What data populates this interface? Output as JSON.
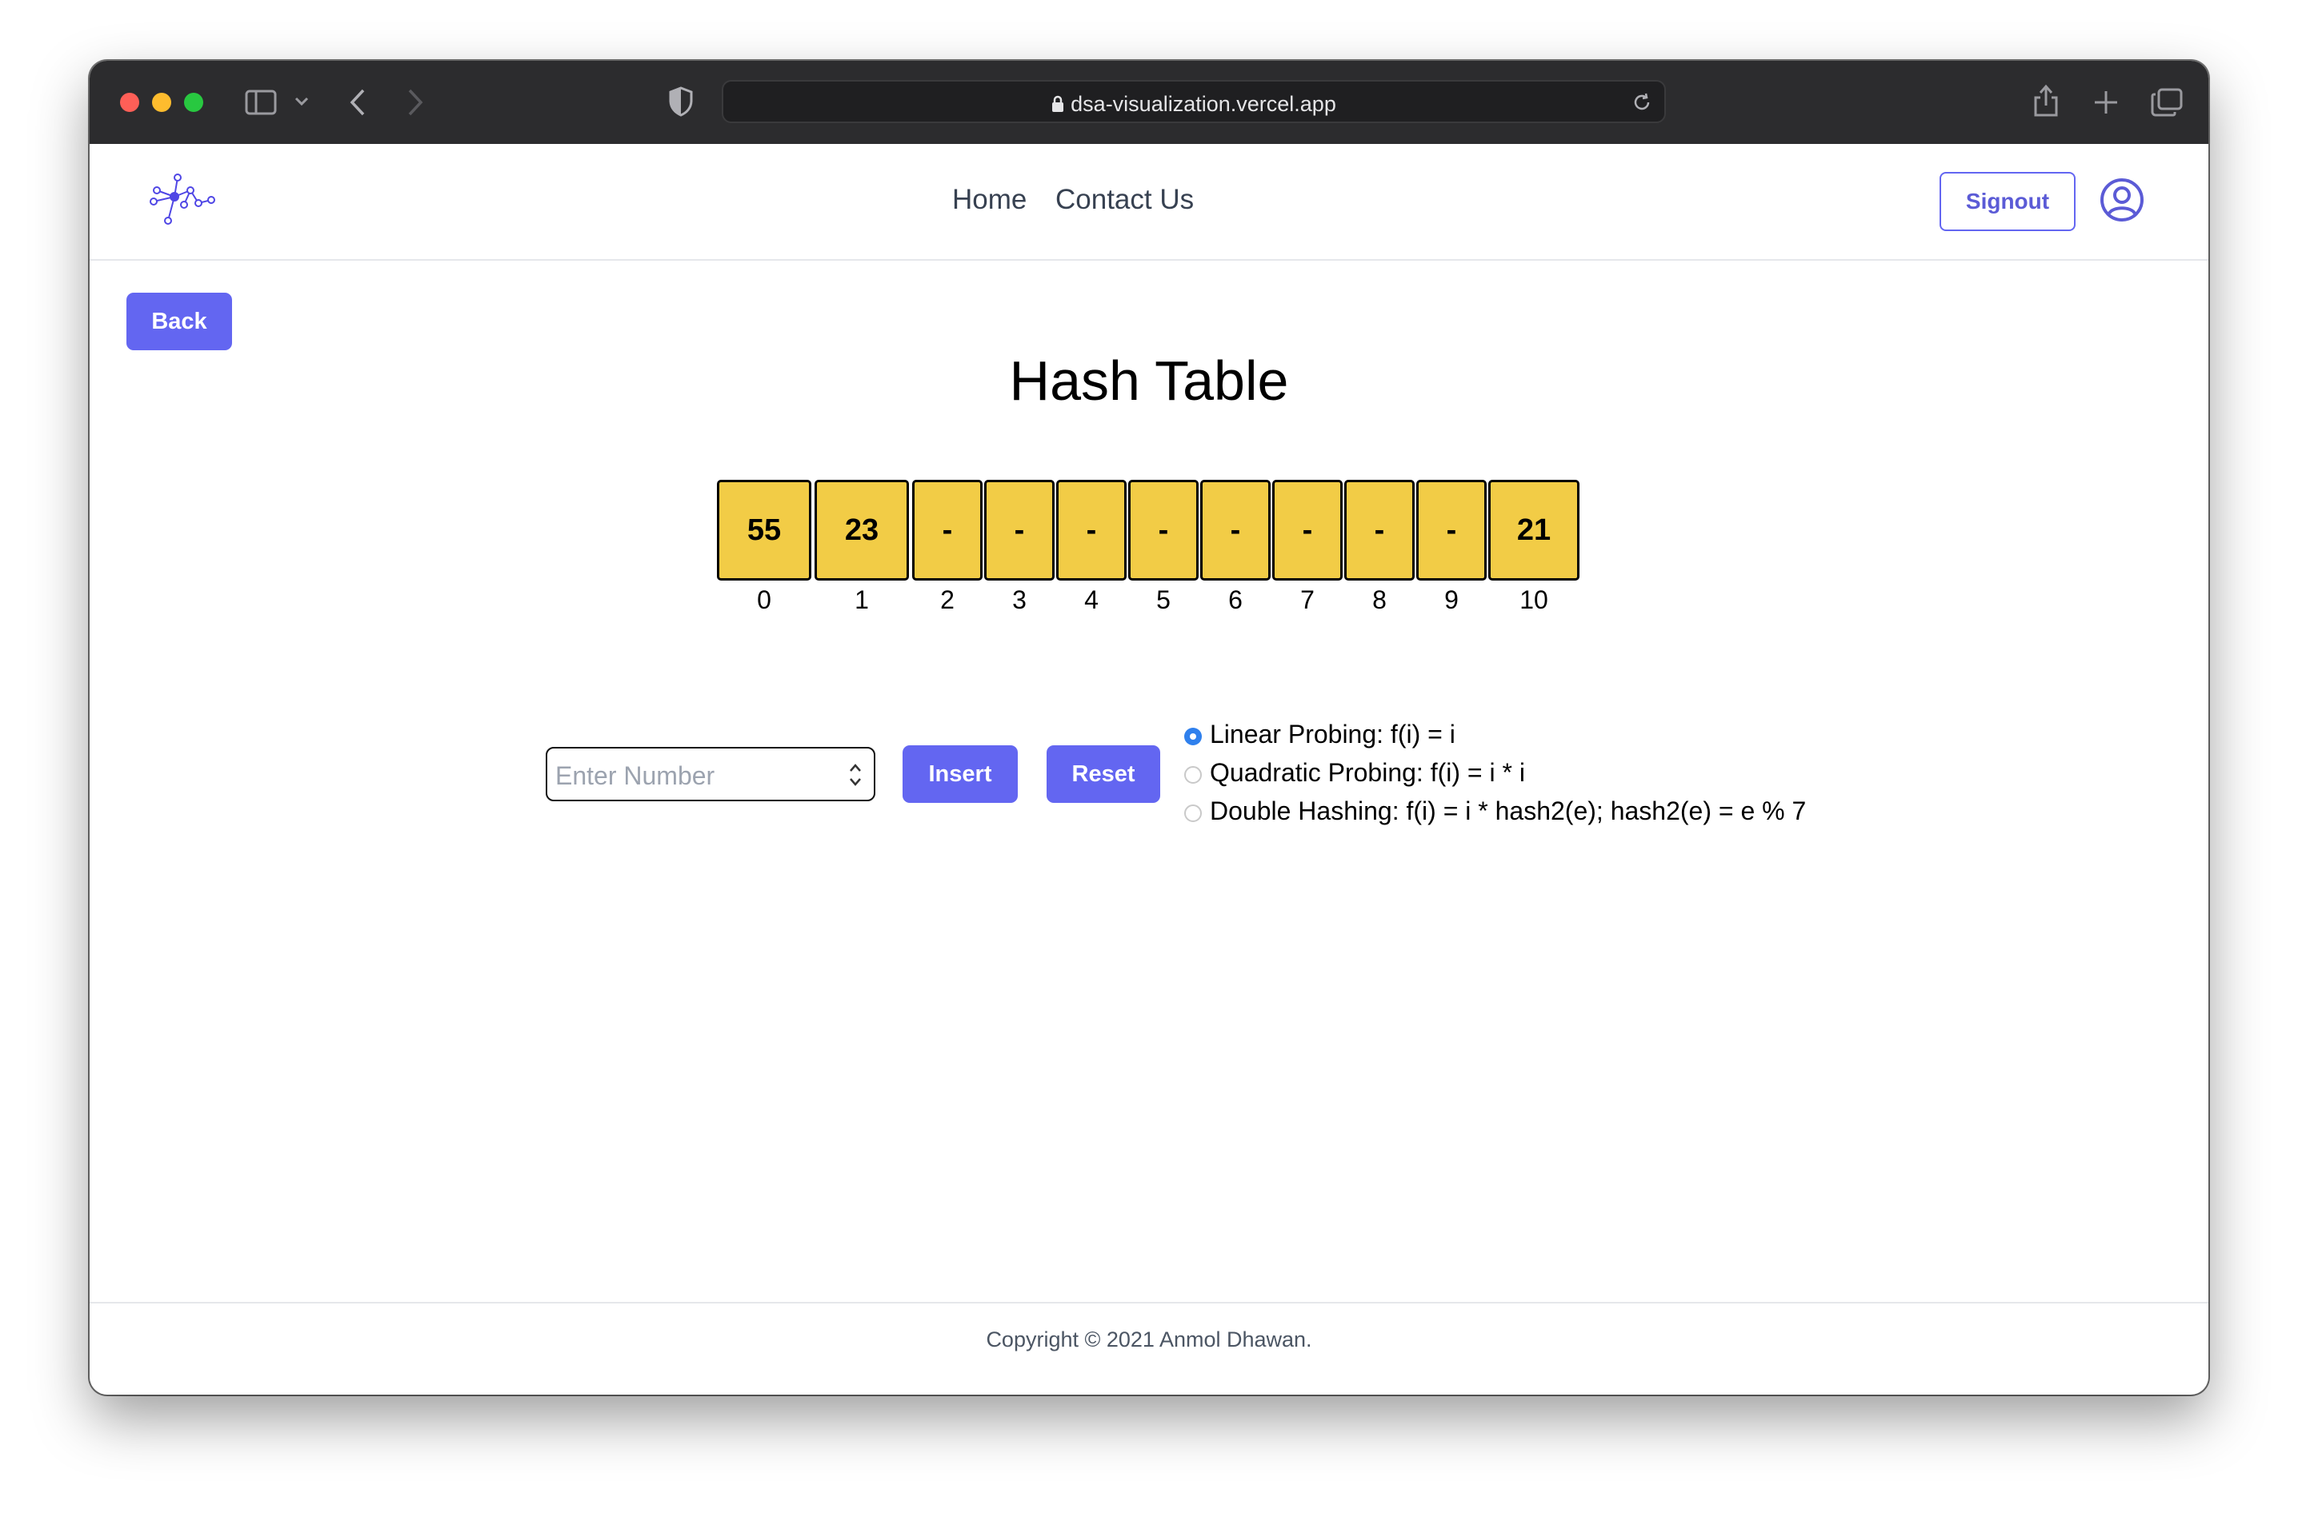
{
  "browser": {
    "url": "dsa-visualization.vercel.app"
  },
  "nav": {
    "links": [
      "Home",
      "Contact Us"
    ],
    "signout_label": "Signout"
  },
  "page": {
    "back_label": "Back",
    "title": "Hash Table"
  },
  "hash_table": {
    "cells": [
      {
        "index": "0",
        "value": "55"
      },
      {
        "index": "1",
        "value": "23"
      },
      {
        "index": "2",
        "value": "-"
      },
      {
        "index": "3",
        "value": "-"
      },
      {
        "index": "4",
        "value": "-"
      },
      {
        "index": "5",
        "value": "-"
      },
      {
        "index": "6",
        "value": "-"
      },
      {
        "index": "7",
        "value": "-"
      },
      {
        "index": "8",
        "value": "-"
      },
      {
        "index": "9",
        "value": "-"
      },
      {
        "index": "10",
        "value": "21"
      }
    ]
  },
  "controls": {
    "input_placeholder": "Enter Number",
    "insert_label": "Insert",
    "reset_label": "Reset",
    "probing_options": [
      {
        "label": "Linear Probing: f(i) = i",
        "selected": true
      },
      {
        "label": "Quadratic Probing: f(i) = i * i",
        "selected": false
      },
      {
        "label": "Double Hashing: f(i) = i * hash2(e); hash2(e) = e % 7",
        "selected": false
      }
    ]
  },
  "footer": {
    "copyright": "Copyright © 2021 Anmol Dhawan."
  },
  "colors": {
    "accent": "#6366f1",
    "cell_fill": "#f2cc46",
    "radio_selected": "#2f80ed"
  }
}
